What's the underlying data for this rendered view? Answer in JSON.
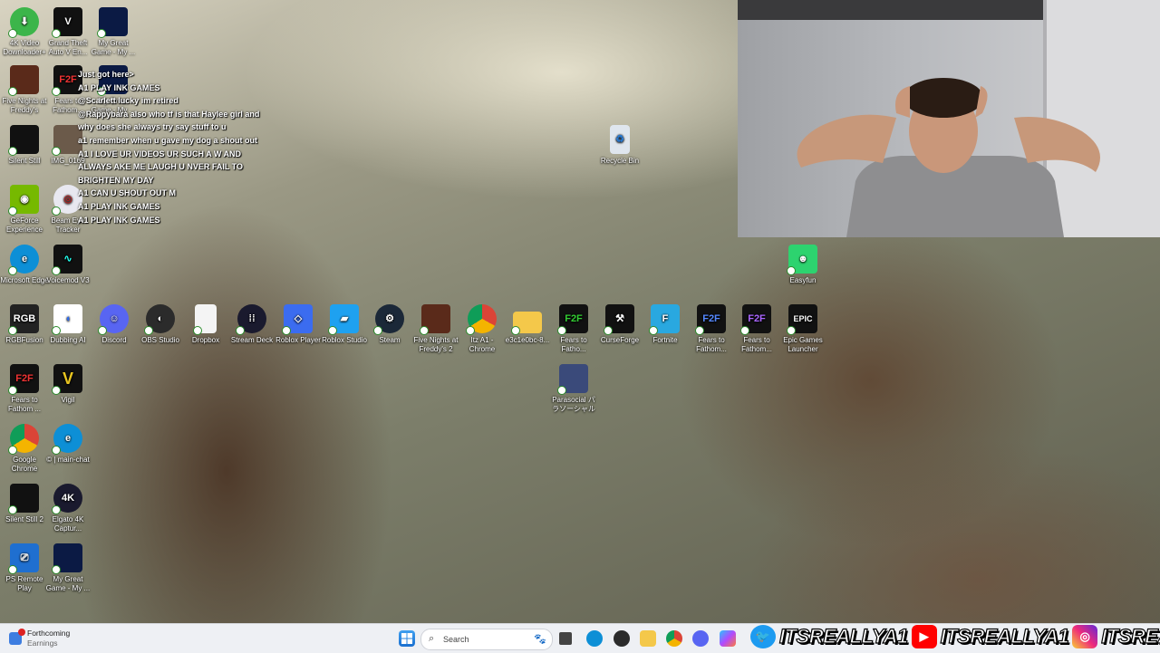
{
  "desktop_icons": [
    {
      "label": "4K Video Downloader+",
      "name": "4k-video-downloader-icon",
      "color": "#3cb54a"
    },
    {
      "label": "Grand Theft Auto V En...",
      "name": "gta-v-icon",
      "color": "#111111"
    },
    {
      "label": "My Great Game - My ...",
      "name": "my-great-game-icon",
      "color": "#0b1a44"
    },
    {
      "label": "Five Nights at Freddy's",
      "name": "fnaf-icon",
      "color": "#5a2a1a"
    },
    {
      "label": "Fears to Fathom...",
      "name": "fears-to-fathom-icon",
      "color": "#111111"
    },
    {
      "label": "My Great Game - My ...",
      "name": "my-great-game-2-icon",
      "color": "#0b1a44"
    },
    {
      "label": "Silent Still",
      "name": "silent-still-icon",
      "color": "#111111"
    },
    {
      "label": "IMG_0169",
      "name": "img-file-icon",
      "color": "#6b5a4a"
    },
    {
      "label": "GeForce Experience",
      "name": "geforce-icon",
      "color": "#76b900"
    },
    {
      "label": "Beam Eye Tracker",
      "name": "beam-eye-tracker-icon",
      "color": "#e8e8f0"
    },
    {
      "label": "Microsoft Edge",
      "name": "edge-icon",
      "color": "#0d8fd6"
    },
    {
      "label": "Voicemod V3",
      "name": "voicemod-icon",
      "color": "#111111"
    },
    {
      "label": "RGBFusion",
      "name": "rgbfusion-icon",
      "color": "#222222"
    },
    {
      "label": "Dubbing AI",
      "name": "dubbing-ai-icon",
      "color": "#ffffff"
    },
    {
      "label": "Discord",
      "name": "discord-icon",
      "color": "#5865f2"
    },
    {
      "label": "OBS Studio",
      "name": "obs-icon",
      "color": "#2b2b2b"
    },
    {
      "label": "Dropbox",
      "name": "dropbox-file-icon",
      "color": "#f4f4f4"
    },
    {
      "label": "Stream Deck",
      "name": "stream-deck-icon",
      "color": "#1a1a2e"
    },
    {
      "label": "Roblox Player",
      "name": "roblox-player-icon",
      "color": "#3b6cf0"
    },
    {
      "label": "Roblox Studio",
      "name": "roblox-studio-icon",
      "color": "#1ea1f0"
    },
    {
      "label": "Steam",
      "name": "steam-icon",
      "color": "#1b2838"
    },
    {
      "label": "Five Nights at Freddy's 2",
      "name": "fnaf2-icon",
      "color": "#5a2a1a"
    },
    {
      "label": "Itz A1 - Chrome",
      "name": "chrome-profile-icon",
      "color": "#db4437"
    },
    {
      "label": "e3c1e0bc-8...",
      "name": "folder-icon",
      "color": "#f4c84a"
    },
    {
      "label": "Fears to Fatho...",
      "name": "fears-to-fathom-2-icon",
      "color": "#111111"
    },
    {
      "label": "CurseForge",
      "name": "curseforge-icon",
      "color": "#111111"
    },
    {
      "label": "Fortnite",
      "name": "fortnite-icon",
      "color": "#29a8e0"
    },
    {
      "label": "Fears to Fathom...",
      "name": "fears-to-fathom-3-icon",
      "color": "#111111"
    },
    {
      "label": "Fears to Fathom...",
      "name": "fears-to-fathom-4-icon",
      "color": "#111111"
    },
    {
      "label": "Epic Games Launcher",
      "name": "epic-games-icon",
      "color": "#111111"
    },
    {
      "label": "Fears to Fathom ...",
      "name": "fears-to-fathom-5-icon",
      "color": "#111111"
    },
    {
      "label": "Vigil",
      "name": "vigil-icon",
      "color": "#111111"
    },
    {
      "label": "Parasocial パラソーシャル",
      "name": "parasocial-icon",
      "color": "#3a4a7a"
    },
    {
      "label": "Google Chrome",
      "name": "google-chrome-icon",
      "color": "#db4437"
    },
    {
      "label": "© | main-chat",
      "name": "main-chat-edge-icon",
      "color": "#0d8fd6"
    },
    {
      "label": "Silent Still 2",
      "name": "silent-still-2-icon",
      "color": "#111111"
    },
    {
      "label": "Elgato 4K Captur...",
      "name": "elgato-icon",
      "color": "#1a1a2e"
    },
    {
      "label": "PS Remote Play",
      "name": "ps-remote-play-icon",
      "color": "#1f6fd0"
    },
    {
      "label": "My Great Game - My ...",
      "name": "my-great-game-3-icon",
      "color": "#0b1a44"
    },
    {
      "label": "Recycle Bin",
      "name": "recycle-bin-icon",
      "color": "#dfe6ee"
    },
    {
      "label": "Easyfun",
      "name": "easyfun-icon",
      "color": "#2dd36f"
    }
  ],
  "chat": {
    "lines": [
      "Just got here>",
      "A1 PLAY INK GAMES",
      "@Scarlett lucky im retired",
      "@Rappybara also who tf is that Haylee girl and",
      "why does she always try say stuff to u",
      "a1 remember when u gave my dog a shout out",
      "A1 I LOVE UR VIDEOS UR SUCH A W AND",
      "ALWAYS AKE ME LAUGH U NVER FAIL TO",
      "BRIGHTEN MY DAY",
      "A1 CAN U SHOUT OUT M",
      "A1 PLAY INK GAMES",
      "A1 PLAY INK GAMES"
    ]
  },
  "taskbar": {
    "weather_title": "Forthcoming",
    "weather_sub": "Earnings",
    "search_placeholder": "Search"
  },
  "social": {
    "twitter": "ITSREALLYA1",
    "youtube": "ITSREALLYA1",
    "instagram": "ITSREALLYA1"
  }
}
